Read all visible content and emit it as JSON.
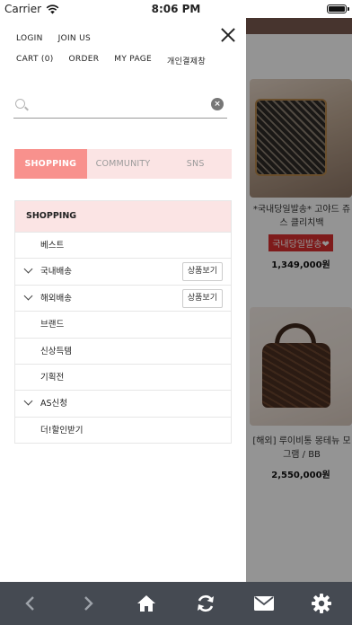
{
  "status_bar": {
    "carrier": "Carrier",
    "time": "8:06 PM"
  },
  "drawer": {
    "top_links_row1": [
      "LOGIN",
      "JOIN US"
    ],
    "top_links_row2": [
      "CART (0)",
      "ORDER",
      "MY PAGE",
      "개인결제창"
    ],
    "search": {
      "value": "",
      "placeholder": ""
    },
    "tabs": [
      {
        "label": "SHOPPING",
        "active": true
      },
      {
        "label": "COMMUNITY",
        "active": false
      },
      {
        "label": "SNS",
        "active": false
      }
    ],
    "menu": {
      "header": "SHOPPING",
      "items": [
        {
          "label": "베스트",
          "expandable": false,
          "view_label": ""
        },
        {
          "label": "국내배송",
          "expandable": true,
          "view_label": "상품보기"
        },
        {
          "label": "해외배송",
          "expandable": true,
          "view_label": "상품보기"
        },
        {
          "label": "브랜드",
          "expandable": false,
          "view_label": ""
        },
        {
          "label": "신상득템",
          "expandable": false,
          "view_label": ""
        },
        {
          "label": "기획전",
          "expandable": false,
          "view_label": ""
        },
        {
          "label": "AS신청",
          "expandable": true,
          "view_label": ""
        },
        {
          "label": "더!할인받기",
          "expandable": false,
          "view_label": ""
        }
      ]
    }
  },
  "background_products": [
    {
      "name": "*국내당일발송* 고야드 쥬",
      "name_line2": "스 클리치백",
      "tag": "국내당일발송❤",
      "price": "1,349,000원"
    },
    {
      "name": "[해외] 루이비통 몽테뉴 모",
      "name_line2": "그램 / BB",
      "tag": "",
      "price": "2,550,000원"
    }
  ],
  "toolbar": {
    "icons": [
      "back-arrow-icon",
      "forward-arrow-icon",
      "home-icon",
      "refresh-icon",
      "mail-icon",
      "gear-icon"
    ],
    "color": "#454a52"
  },
  "colors": {
    "accent_pink": "#f8918d",
    "light_pink": "#fbe4e4",
    "sale_red": "#d9302f"
  }
}
